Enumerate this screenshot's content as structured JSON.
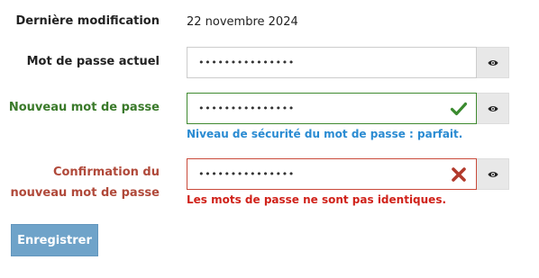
{
  "last_modified": {
    "label": "Dernière modification",
    "value": "22 novembre 2024"
  },
  "current_password": {
    "label": "Mot de passe actuel",
    "value": "•••••••••••••••"
  },
  "new_password": {
    "label": "Nouveau mot de passe",
    "value": "•••••••••••••••",
    "status_icon": "check-icon",
    "strength_message": "Niveau de sécurité du mot de passe : parfait."
  },
  "confirm_password": {
    "label_line1": "Confirmation du",
    "label_line2": "nouveau mot de passe",
    "value": "•••••••••••••••",
    "status_icon": "cross-icon",
    "error_message": "Les mots de passe ne sont pas identiques."
  },
  "actions": {
    "save_label": "Enregistrer"
  },
  "icons": {
    "reveal": "eye-icon"
  },
  "colors": {
    "success": "#3a7a2a",
    "error": "#d0221a",
    "info": "#2a8bd2",
    "button": "#6fa3c9"
  }
}
